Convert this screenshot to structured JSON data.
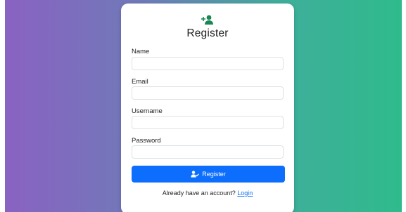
{
  "colors": {
    "gradient_start": "#8a62c2",
    "gradient_end": "#2fbb8c",
    "primary": "#0d6efd",
    "icon_green": "#198754"
  },
  "header": {
    "icon": "person-plus-icon",
    "title": "Register"
  },
  "form": {
    "fields": [
      {
        "label": "Name",
        "value": "",
        "placeholder": ""
      },
      {
        "label": "Email",
        "value": "",
        "placeholder": ""
      },
      {
        "label": "Username",
        "value": "",
        "placeholder": ""
      },
      {
        "label": "Password",
        "value": "",
        "placeholder": ""
      }
    ],
    "submit": {
      "icon": "person-check-icon",
      "label": "Register"
    }
  },
  "footer": {
    "prompt": "Already have an account?",
    "link_label": "Login"
  }
}
